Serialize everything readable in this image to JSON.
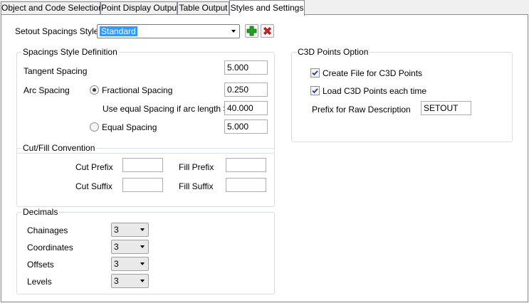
{
  "tabs": [
    {
      "label": "Object and Code Selection"
    },
    {
      "label": "Point Display Output"
    },
    {
      "label": "Table Output"
    },
    {
      "label": "Styles and Settings"
    }
  ],
  "style_row": {
    "label": "Setout Spacings Style",
    "value": "Standard"
  },
  "spacings": {
    "title": "Spacings Style Definition",
    "tangent_label": "Tangent Spacing",
    "tangent_value": "5.000",
    "arc_label": "Arc Spacing",
    "fractional_label": "Fractional Spacing",
    "fractional_value": "0.250",
    "equal_if_label": "Use equal Spacing if arc length >",
    "equal_if_value": "40.000",
    "equal_label": "Equal Spacing",
    "equal_value": "5.000"
  },
  "cutfill": {
    "title": "Cut/Fill Convention",
    "cut_prefix_label": "Cut Prefix",
    "cut_prefix_value": "",
    "fill_prefix_label": "Fill Prefix",
    "fill_prefix_value": "",
    "cut_suffix_label": "Cut Suffix",
    "cut_suffix_value": "",
    "fill_suffix_label": "Fill Suffix",
    "fill_suffix_value": ""
  },
  "decimals": {
    "title": "Decimals",
    "items": [
      {
        "label": "Chainages",
        "value": "3"
      },
      {
        "label": "Coordinates",
        "value": "3"
      },
      {
        "label": "Offsets",
        "value": "3"
      },
      {
        "label": "Levels",
        "value": "3"
      }
    ]
  },
  "c3d": {
    "title": "C3D Points Option",
    "create_label": "Create File for C3D Points",
    "load_label": "Load C3D Points each time",
    "prefix_label": "Prefix for Raw Description",
    "prefix_value": "SETOUT"
  },
  "colors": {
    "selection": "#3399ff",
    "add_green": "#1fa31f",
    "delete_red": "#d42020"
  }
}
